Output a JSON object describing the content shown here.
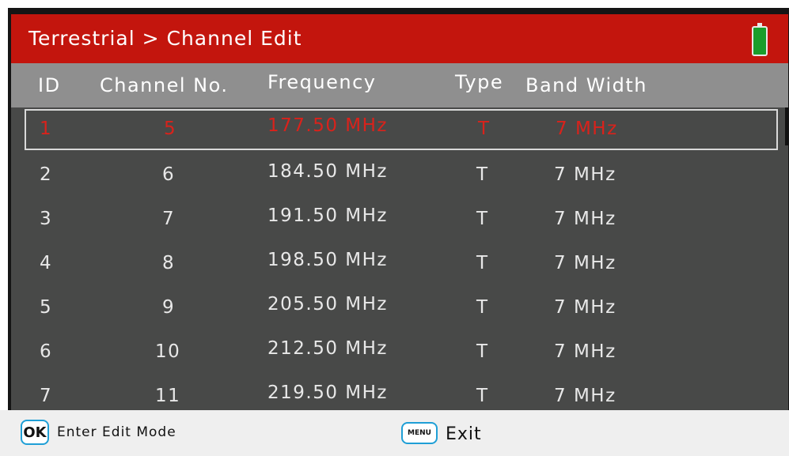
{
  "titlebar": {
    "title": "Terrestrial > Channel Edit"
  },
  "status": {
    "battery_icon": "battery-full-icon",
    "battery_color": "#1a9d2b"
  },
  "table": {
    "columns": [
      "ID",
      "Channel No.",
      "Frequency",
      "Type",
      "Band Width"
    ],
    "rows": [
      {
        "id": "1",
        "channel": "5",
        "frequency": "177.50 MHz",
        "type": "T",
        "bandwidth": "7 MHz",
        "selected": true
      },
      {
        "id": "2",
        "channel": "6",
        "frequency": "184.50 MHz",
        "type": "T",
        "bandwidth": "7 MHz"
      },
      {
        "id": "3",
        "channel": "7",
        "frequency": "191.50 MHz",
        "type": "T",
        "bandwidth": "7 MHz"
      },
      {
        "id": "4",
        "channel": "8",
        "frequency": "198.50 MHz",
        "type": "T",
        "bandwidth": "7 MHz"
      },
      {
        "id": "5",
        "channel": "9",
        "frequency": "205.50 MHz",
        "type": "T",
        "bandwidth": "7 MHz"
      },
      {
        "id": "6",
        "channel": "10",
        "frequency": "212.50 MHz",
        "type": "T",
        "bandwidth": "7 MHz"
      },
      {
        "id": "7",
        "channel": "11",
        "frequency": "219.50 MHz",
        "type": "T",
        "bandwidth": "7 MHz"
      }
    ]
  },
  "footer": {
    "ok_key": "OK",
    "ok_label": "Enter Edit Mode",
    "menu_key": "MENU",
    "menu_label": "Exit"
  },
  "colors": {
    "title_bar": "#c3150d",
    "header": "#8f8f8f",
    "list_bg": "#484948",
    "selected_text": "#d9221b",
    "key_border": "#1f9fd6"
  }
}
